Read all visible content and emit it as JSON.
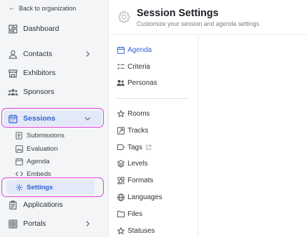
{
  "sidebar": {
    "back_label": "Back to organization",
    "items": [
      {
        "label": "Dashboard",
        "icon": "dashboard-icon"
      },
      {
        "label": "Contacts",
        "icon": "user-icon"
      },
      {
        "label": "Exhibitors",
        "icon": "store-icon"
      },
      {
        "label": "Sponsors",
        "icon": "people-group-icon"
      },
      {
        "label": "Sessions",
        "icon": "calendar-icon"
      },
      {
        "label": "Applications",
        "icon": "clipboard-icon"
      },
      {
        "label": "Portals",
        "icon": "portal-icon"
      }
    ],
    "sessions_subitems": [
      {
        "label": "Submissions",
        "icon": "document-icon"
      },
      {
        "label": "Evaluation",
        "icon": "image-icon"
      },
      {
        "label": "Agenda",
        "icon": "calendar-small-icon"
      },
      {
        "label": "Embeds",
        "icon": "code-icon"
      },
      {
        "label": "Settings",
        "icon": "gear-icon"
      }
    ]
  },
  "header": {
    "title": "Session Settings",
    "subtitle": "Customize your session and agenda settings"
  },
  "settings_menu": {
    "group1": [
      {
        "label": "Agenda",
        "icon": "calendar-icon"
      },
      {
        "label": "Criteria",
        "icon": "checklist-icon"
      },
      {
        "label": "Personas",
        "icon": "people-icon"
      }
    ],
    "group2": [
      {
        "label": "Rooms",
        "icon": "rooms-icon"
      },
      {
        "label": "Tracks",
        "icon": "tracks-icon"
      },
      {
        "label": "Tags",
        "icon": "tag-icon"
      },
      {
        "label": "Levels",
        "icon": "layers-icon"
      },
      {
        "label": "Formats",
        "icon": "formats-icon"
      },
      {
        "label": "Languages",
        "icon": "globe-icon"
      },
      {
        "label": "Files",
        "icon": "folder-icon"
      },
      {
        "label": "Statuses",
        "icon": "star-icon"
      }
    ]
  },
  "colors": {
    "accent": "#2f5fd0",
    "highlight_ring": "#e23fe0",
    "selected_bg": "#e3e9f8",
    "sidebar_bg": "#f4f5f6"
  }
}
